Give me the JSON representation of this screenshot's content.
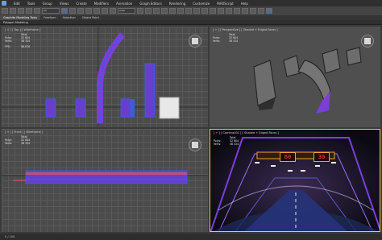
{
  "app": {
    "title": "Autodesk 3ds Max"
  },
  "menu": [
    "Edit",
    "Tools",
    "Group",
    "Views",
    "Create",
    "Modifiers",
    "Animation",
    "Graph Editors",
    "Rendering",
    "Customize",
    "MAXScript",
    "Help"
  ],
  "toolbar": {
    "selection_filter": "All",
    "view_dropdown": "View"
  },
  "ribbon": {
    "tabs": [
      "Graphite Modeling Tools",
      "Freeform",
      "Selection",
      "Object Paint"
    ],
    "active_tab": "Graphite Modeling Tools",
    "sub_label": "Polygon Modeling"
  },
  "viewports": {
    "top_left": {
      "label": "[ + ] [ Top ] [ Wireframe ]",
      "stats": {
        "header": "Total",
        "polys_label": "Polys:",
        "polys": "32 604",
        "verts_label": "Verts:",
        "verts": "38 324",
        "fps_label": "FPS:",
        "fps": "98.876"
      }
    },
    "top_right": {
      "label": "[ + ] [ Perspective ] [ Shaded + Edged Faces ]",
      "stats": {
        "header": "Total",
        "polys_label": "Polys:",
        "polys": "32 604",
        "verts_label": "Verts:",
        "verts": "38 324"
      }
    },
    "bottom_left": {
      "label": "[ + ] [ Front ] [ Wireframe ]",
      "stats": {
        "header": "Total",
        "polys_label": "Polys:",
        "polys": "32 604",
        "verts_label": "Verts:",
        "verts": "38 324"
      }
    },
    "bottom_right": {
      "label": "[ + ] [ Camera001 ] [ Shaded + Edged Faces ]",
      "stats": {
        "header": "Total",
        "polys_label": "Polys:",
        "polys": "32 604",
        "verts_label": "Verts:",
        "verts": "38 324"
      },
      "sign_left": "60",
      "sign_right": "30"
    }
  },
  "status": {
    "frame_counter": "0 / 100"
  },
  "colors": {
    "active_border": "#e6d23a",
    "wire_purple": "#7b3fd9",
    "wire_blue": "#3a5ce0",
    "sign_orange": "#f2a22a"
  }
}
